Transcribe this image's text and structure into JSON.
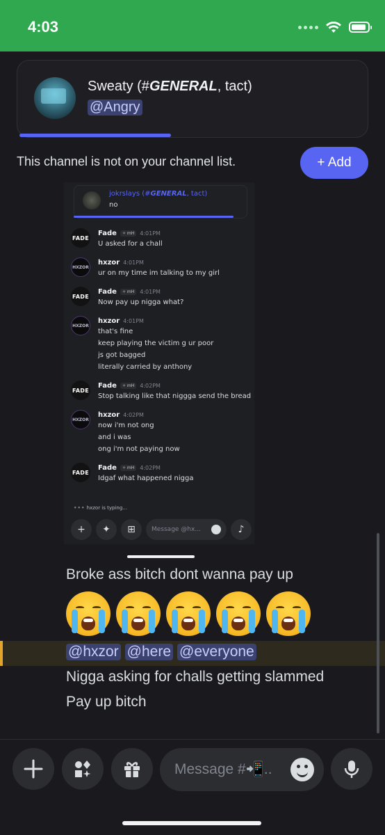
{
  "status_bar": {
    "time": "4:03"
  },
  "reference": {
    "title_prefix": "Sweaty (#",
    "title_channel": "GENERAL",
    "title_suffix": ", tact)",
    "mention": "@Angry"
  },
  "notice": {
    "text": "This channel is not on your channel list.",
    "add_label": "+ Add"
  },
  "embedded": {
    "reply": {
      "name_prefix": "jokrslays (#",
      "name_channel": "GENERAL",
      "name_suffix": ", tact)",
      "text": "no"
    },
    "messages": [
      {
        "author": "Fade",
        "avatar": "FADE",
        "tag": "✧ mH",
        "time": "4:01PM",
        "lines": [
          "U asked for a chall"
        ]
      },
      {
        "author": "hxzor",
        "avatar": "HXZOR",
        "tag": "",
        "time": "4:01PM",
        "lines": [
          "ur on my time im talking to my girl"
        ]
      },
      {
        "author": "Fade",
        "avatar": "FADE",
        "tag": "✧ mH",
        "time": "4:01PM",
        "lines": [
          "Now pay up nigga what?"
        ]
      },
      {
        "author": "hxzor",
        "avatar": "HXZOR",
        "tag": "",
        "time": "4:01PM",
        "lines": [
          "that's fine",
          "keep playing the victim g ur poor",
          "js got bagged",
          "literally carried by anthony"
        ]
      },
      {
        "author": "Fade",
        "avatar": "FADE",
        "tag": "✧ mH",
        "time": "4:02PM",
        "lines": [
          "Stop talking like that niggga send the bread"
        ]
      },
      {
        "author": "hxzor",
        "avatar": "HXZOR",
        "tag": "",
        "time": "4:02PM",
        "lines": [
          "now i'm not ong",
          "and i was",
          "ong i'm not paying now"
        ]
      },
      {
        "author": "Fade",
        "avatar": "FADE",
        "tag": "✧ mH",
        "time": "4:02PM",
        "lines": [
          "Idgaf what happened nigga"
        ]
      }
    ],
    "typing": "hxzor is typing...",
    "input_placeholder": "Message @hx..."
  },
  "chat": {
    "line1": "Broke ass bitch dont wanna pay up",
    "mentions": [
      "@hxzor",
      "@here",
      "@everyone"
    ],
    "line2": "Nigga asking for challs getting slammed",
    "line3": "Pay up bitch"
  },
  "composer": {
    "placeholder": "Message #📲.."
  },
  "icons": {
    "plus": "plus-icon",
    "apps": "apps-icon",
    "gift": "gift-icon",
    "emoji": "emoji-icon",
    "mic": "microphone-icon",
    "wifi": "wifi-icon",
    "battery": "battery-icon"
  },
  "colors": {
    "status_bar": "#2fa84f",
    "accent": "#5865f2",
    "background": "#1a1a1e",
    "mention_highlight": "#e2a52a"
  }
}
